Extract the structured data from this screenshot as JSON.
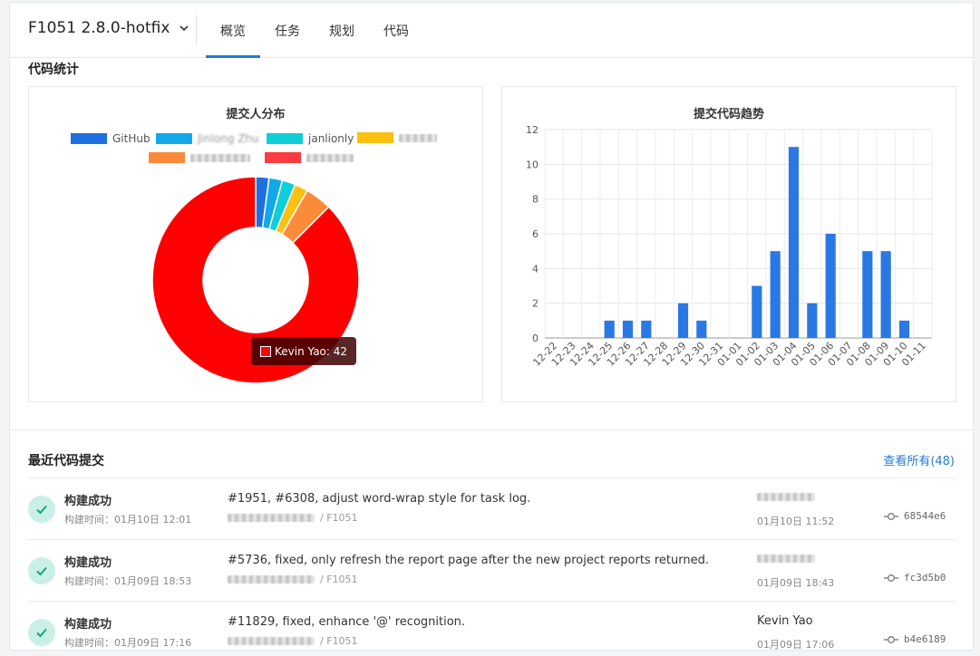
{
  "header": {
    "project": "F1051 2.8.0-hotfix",
    "tabs": [
      {
        "label": "概览",
        "active": true
      },
      {
        "label": "任务",
        "active": false
      },
      {
        "label": "规划",
        "active": false
      },
      {
        "label": "代码",
        "active": false
      }
    ]
  },
  "code_stats": {
    "title": "代码统计"
  },
  "colors": {
    "accent": "#1f7bd6",
    "success_bg": "#c9efe6",
    "success_check": "#1aa57a"
  },
  "chart_data": [
    {
      "type": "pie",
      "title": "提交人分布",
      "donut": true,
      "legend": [
        {
          "name": "GitHub",
          "color": "#1e6fe0"
        },
        {
          "name": "Jinlong Zhu",
          "color": "#13a9e9"
        },
        {
          "name": "janlionly",
          "color": "#0ecfd8"
        },
        {
          "name": "",
          "color": "#fdbf10"
        },
        {
          "name": "",
          "color": "#fb8b39"
        },
        {
          "name": "",
          "color": "#fc3a42"
        }
      ],
      "slices": [
        {
          "value": 1,
          "color": "#1e6fe0"
        },
        {
          "value": 1,
          "color": "#13a9e9"
        },
        {
          "value": 1,
          "color": "#0ecfd8"
        },
        {
          "value": 1,
          "color": "#fdbf10"
        },
        {
          "value": 2,
          "color": "#fb8b39"
        },
        {
          "name": "Kevin Yao",
          "value": 42,
          "color": "#ff0000"
        }
      ],
      "tooltip": "Kevin Yao: 42"
    },
    {
      "type": "bar",
      "title": "提交代码趋势",
      "categories": [
        "12-22",
        "12-23",
        "12-24",
        "12-25",
        "12-26",
        "12-27",
        "12-28",
        "12-29",
        "12-30",
        "12-31",
        "01-01",
        "01-02",
        "01-03",
        "01-04",
        "01-05",
        "01-06",
        "01-07",
        "01-08",
        "01-09",
        "01-10",
        "01-11"
      ],
      "values": [
        0,
        0,
        0,
        1,
        1,
        1,
        0,
        2,
        1,
        0,
        0,
        3,
        5,
        11,
        2,
        6,
        0,
        5,
        5,
        1,
        0
      ],
      "ylim": [
        0,
        12
      ],
      "yticks": [
        0,
        2,
        4,
        6,
        8,
        10,
        12
      ],
      "color": "#2a78e4",
      "grid": true
    }
  ],
  "recent": {
    "title": "最近代码提交",
    "view_all": "查看所有(48)",
    "commits": [
      {
        "status": "构建成功",
        "build_time": "构建时间：01月10日 12:01",
        "message": "#1951, #6308, adjust word-wrap style for task log.",
        "repo": "/ F1051",
        "author": "",
        "date": "01月10日 11:52",
        "hash": "68544e6"
      },
      {
        "status": "构建成功",
        "build_time": "构建时间：01月09日 18:53",
        "message": "#5736, fixed, only refresh the report page after the new project reports returned.",
        "repo": "/ F1051",
        "author": "",
        "date": "01月09日 18:43",
        "hash": "fc3d5b0"
      },
      {
        "status": "构建成功",
        "build_time": "构建时间：01月09日 17:16",
        "message": "#11829, fixed, enhance '@' recognition.",
        "repo": "/ F1051",
        "author": "Kevin Yao",
        "date": "01月09日 17:06",
        "hash": "b4e6189"
      }
    ]
  }
}
